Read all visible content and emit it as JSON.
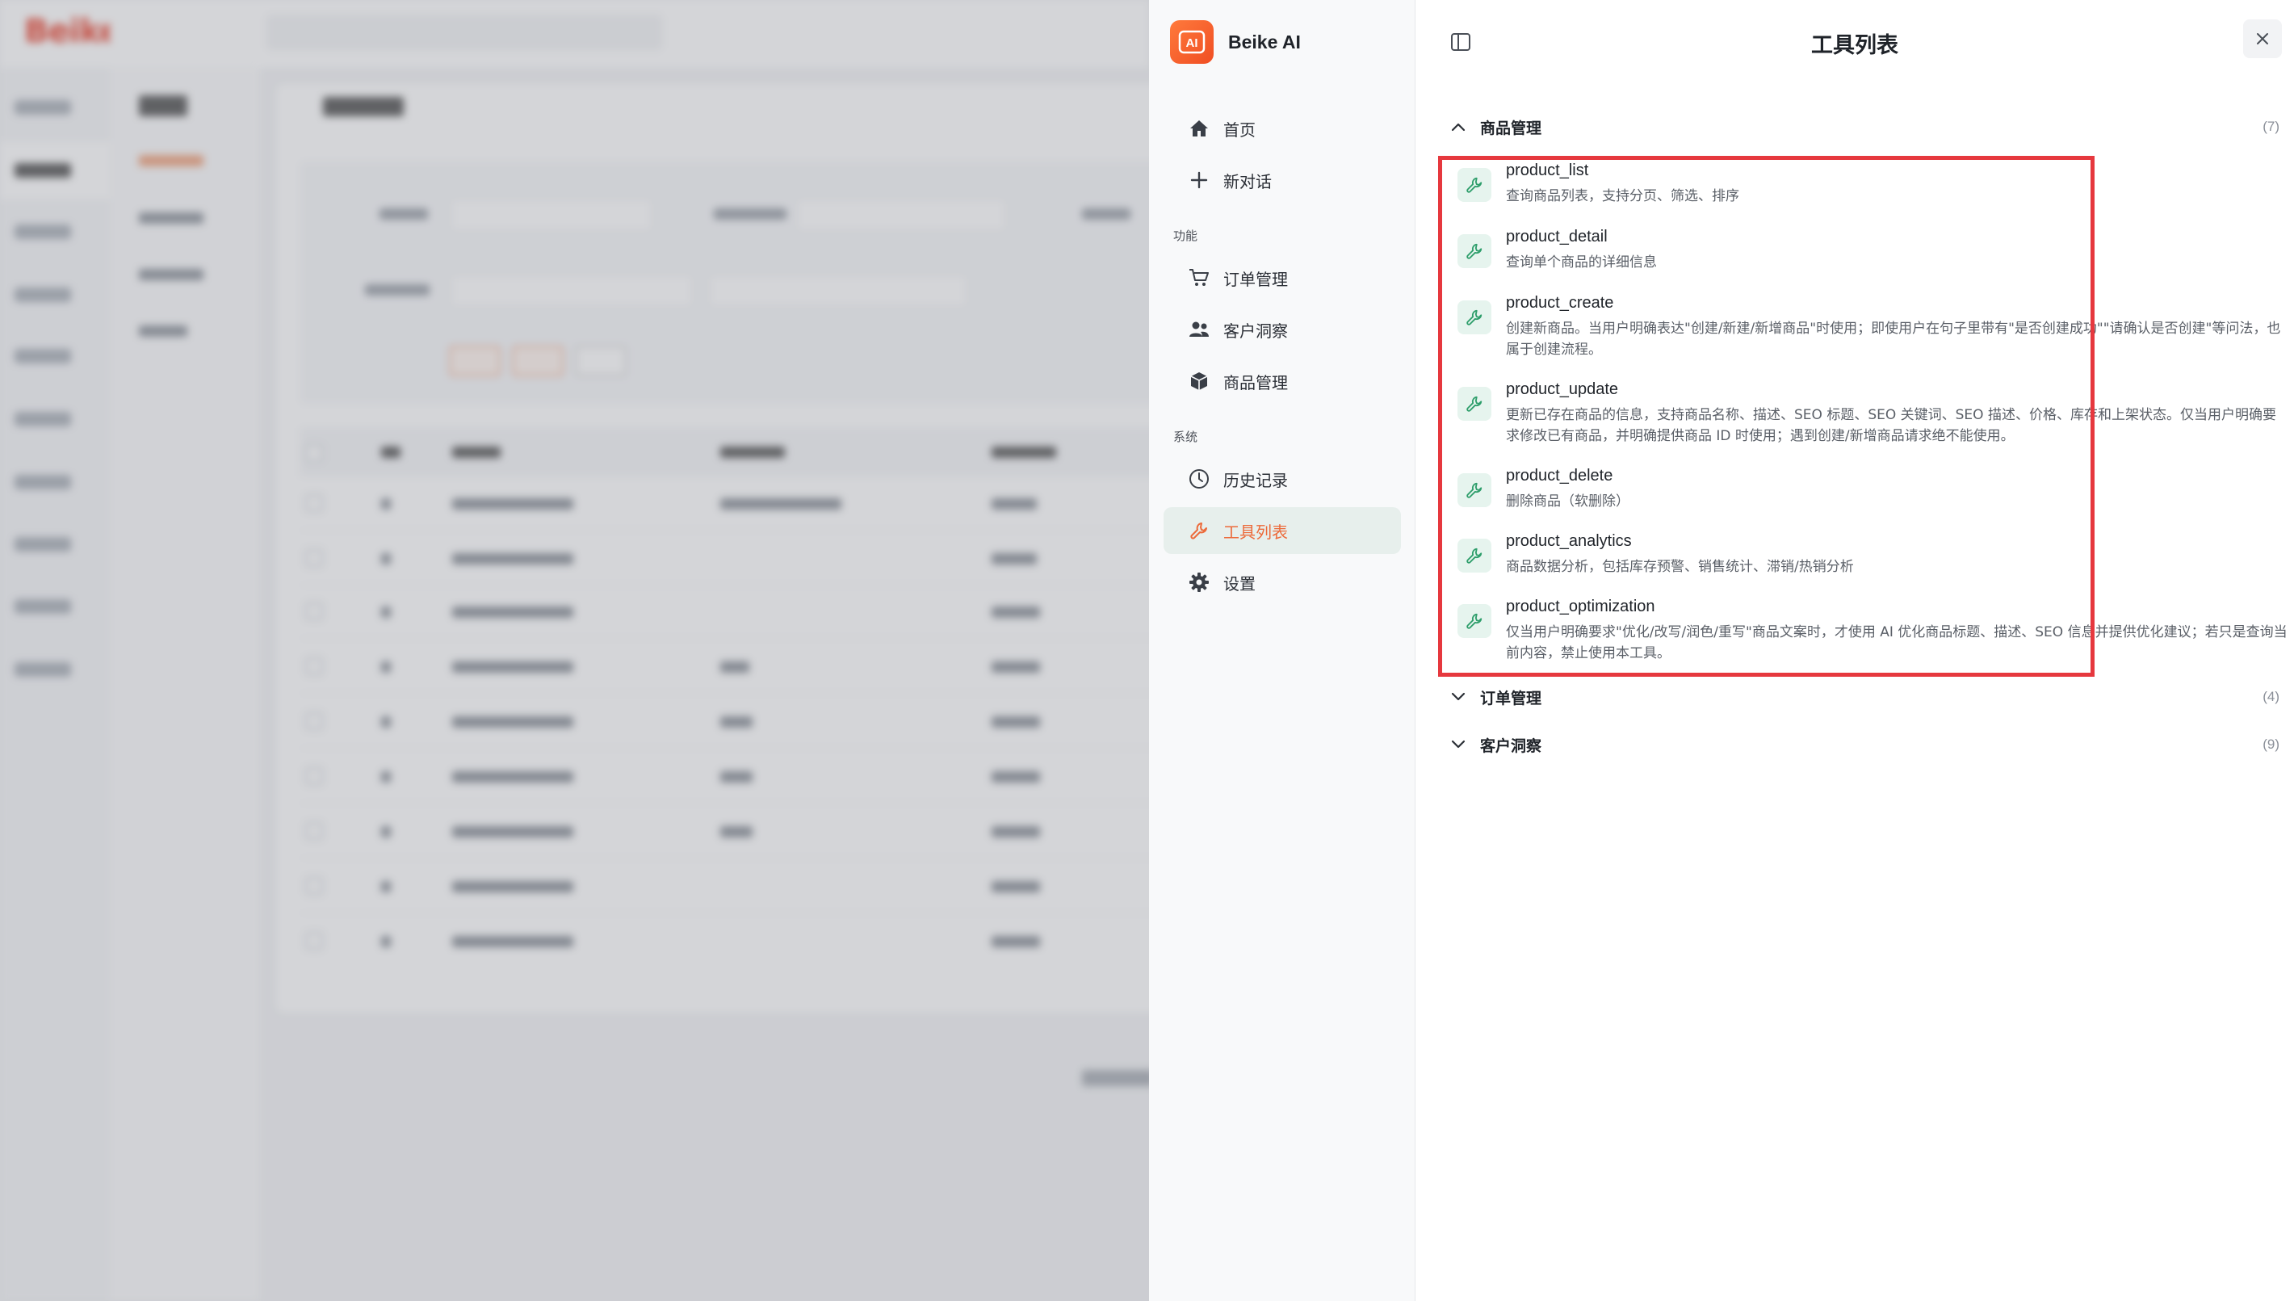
{
  "backdrop": {
    "logo": "BeikeShop"
  },
  "ai_panel": {
    "brand_name": "Beike AI",
    "brand_logo_text": "AI",
    "nav": {
      "home": "首页",
      "new_chat": "新对话",
      "section_features": "功能",
      "orders": "订单管理",
      "customers": "客户洞察",
      "products": "商品管理",
      "section_system": "系统",
      "history": "历史记录",
      "tools": "工具列表",
      "settings": "设置"
    },
    "header": {
      "title": "工具列表"
    },
    "groups": [
      {
        "name": "商品管理",
        "count": "(7)",
        "expanded": true,
        "tools": [
          {
            "name": "product_list",
            "desc": "查询商品列表，支持分页、筛选、排序"
          },
          {
            "name": "product_detail",
            "desc": "查询单个商品的详细信息"
          },
          {
            "name": "product_create",
            "desc": "创建新商品。当用户明确表达\"创建/新建/新增商品\"时使用；即使用户在句子里带有\"是否创建成功\"\"请确认是否创建\"等问法，也属于创建流程。"
          },
          {
            "name": "product_update",
            "desc": "更新已存在商品的信息，支持商品名称、描述、SEO 标题、SEO 关键词、SEO 描述、价格、库存和上架状态。仅当用户明确要求修改已有商品，并明确提供商品 ID 时使用；遇到创建/新增商品请求绝不能使用。"
          },
          {
            "name": "product_delete",
            "desc": "删除商品（软删除）"
          },
          {
            "name": "product_analytics",
            "desc": "商品数据分析，包括库存预警、销售统计、滞销/热销分析"
          },
          {
            "name": "product_optimization",
            "desc": "仅当用户明确要求\"优化/改写/润色/重写\"商品文案时，才使用 AI 优化商品标题、描述、SEO 信息并提供优化建议；若只是查询当前内容，禁止使用本工具。"
          }
        ]
      },
      {
        "name": "订单管理",
        "count": "(4)",
        "expanded": false
      },
      {
        "name": "客户洞察",
        "count": "(9)",
        "expanded": false
      }
    ]
  },
  "colors": {
    "accent": "#ec6a3a",
    "tool_icon_bg": "#e6f4ee",
    "tool_icon_fg": "#2e9e6b",
    "highlight": "#e6383e"
  }
}
